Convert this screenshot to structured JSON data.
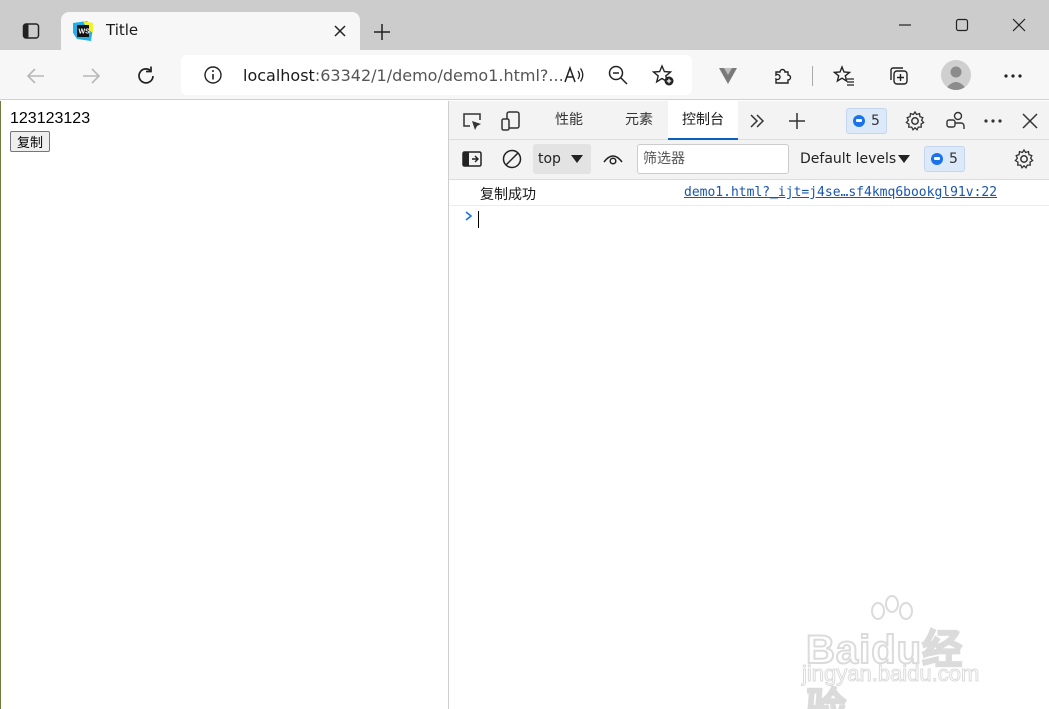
{
  "browser": {
    "tab": {
      "title": "Title",
      "favicon": "webstorm-icon"
    },
    "address": {
      "host": "localhost",
      "rest": ":63342/1/demo/demo1.html?..."
    }
  },
  "page": {
    "text": "123123123",
    "button_label": "复制"
  },
  "devtools": {
    "tabs": [
      {
        "label": "性能",
        "active": false
      },
      {
        "label": "元素",
        "active": false
      },
      {
        "label": "控制台",
        "active": true
      }
    ],
    "issues_count": "5",
    "filter": {
      "context": "top",
      "placeholder": "筛选器",
      "levels": "Default levels",
      "issues_count": "5"
    },
    "console": {
      "messages": [
        {
          "text": "复制成功",
          "source": "demo1.html?_ijt=j4se…sf4kmq6bookgl91v:22"
        }
      ]
    }
  },
  "watermark": {
    "brand": "Baidu经验",
    "sub": "jingyan.baidu.com"
  },
  "colors": {
    "titlebar": "#cccccc",
    "toolbar": "#f7f7f7",
    "devtools_bg": "#f3f3f3",
    "accent": "#0a5fbf",
    "link": "#1a55b0"
  }
}
